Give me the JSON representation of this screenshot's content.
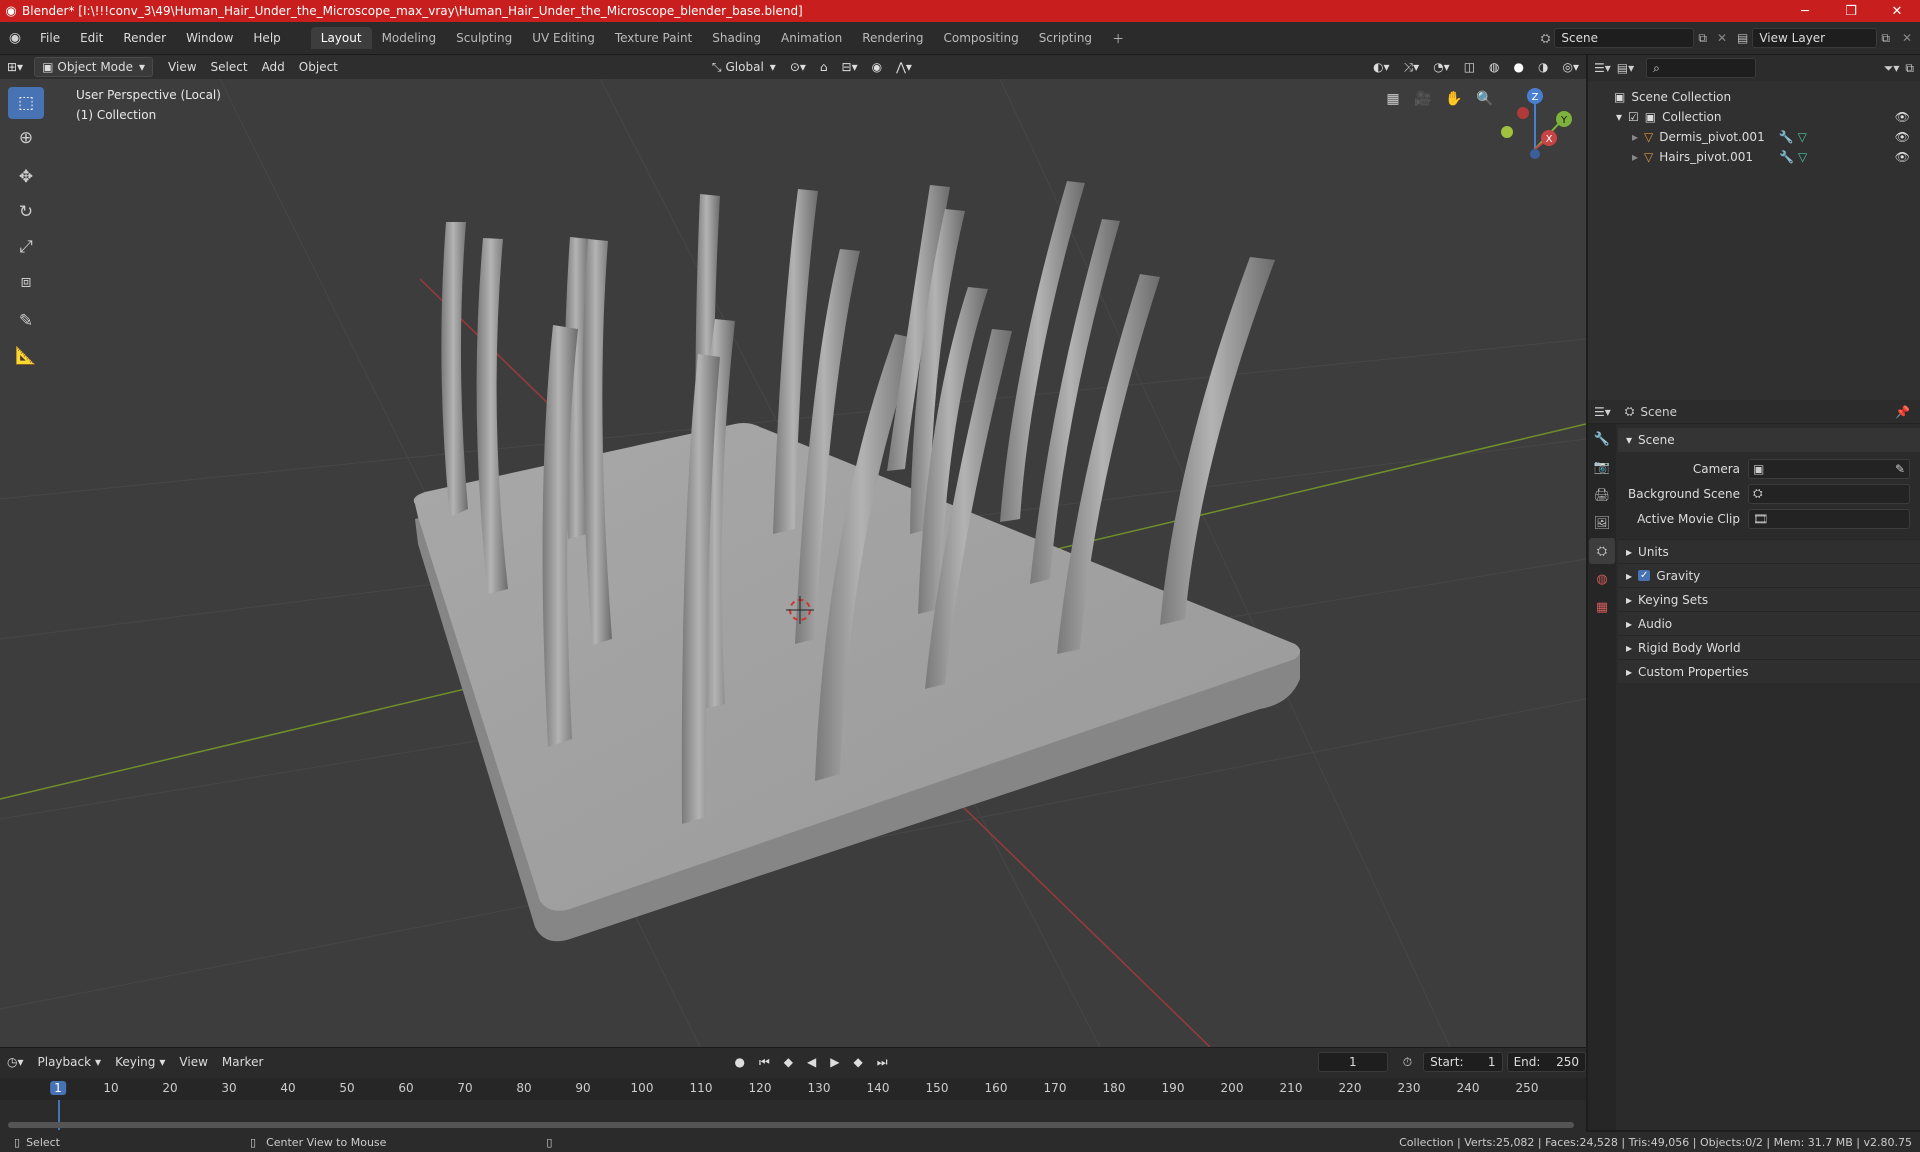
{
  "window": {
    "title": "Blender* [I:\\!!!conv_3\\49\\Human_Hair_Under_the_Microscope_max_vray\\Human_Hair_Under_the_Microscope_blender_base.blend]"
  },
  "menus": [
    "File",
    "Edit",
    "Render",
    "Window",
    "Help"
  ],
  "workspaces": [
    "Layout",
    "Modeling",
    "Sculpting",
    "UV Editing",
    "Texture Paint",
    "Shading",
    "Animation",
    "Rendering",
    "Compositing",
    "Scripting"
  ],
  "active_workspace": "Layout",
  "scene_field": "Scene",
  "view_layer_field": "View Layer",
  "viewport_header": {
    "mode": "Object Mode",
    "menus": [
      "View",
      "Select",
      "Add",
      "Object"
    ],
    "orientation": "Global"
  },
  "viewport": {
    "perspective": "User Perspective (Local)",
    "collection": "(1) Collection"
  },
  "gizmo": {
    "z": "Z",
    "y": "Y",
    "x": "X"
  },
  "outliner": {
    "root": "Scene Collection",
    "collection": "Collection",
    "items": [
      "Dermis_pivot.001",
      "Hairs_pivot.001"
    ]
  },
  "properties": {
    "header": "Scene",
    "panel": "Scene",
    "rows": [
      {
        "label": "Camera"
      },
      {
        "label": "Background Scene"
      },
      {
        "label": "Active Movie Clip"
      }
    ],
    "subpanels": [
      "Units",
      "Gravity",
      "Keying Sets",
      "Audio",
      "Rigid Body World",
      "Custom Properties"
    ]
  },
  "timeline": {
    "menus": [
      "Playback",
      "Keying",
      "View",
      "Marker"
    ],
    "current_frame": "1",
    "start_label": "Start:",
    "start": "1",
    "end_label": "End:",
    "end": "250",
    "ruler": [
      "1",
      "10",
      "20",
      "30",
      "40",
      "50",
      "60",
      "70",
      "80",
      "90",
      "100",
      "110",
      "120",
      "130",
      "140",
      "150",
      "160",
      "170",
      "180",
      "190",
      "200",
      "210",
      "220",
      "230",
      "240",
      "250"
    ]
  },
  "status": {
    "select": "Select",
    "center": "Center View to Mouse",
    "stats": "Collection | Verts:25,082 | Faces:24,528 | Tris:49,056 | Objects:0/2 | Mem: 31.7 MB | v2.80.75"
  }
}
